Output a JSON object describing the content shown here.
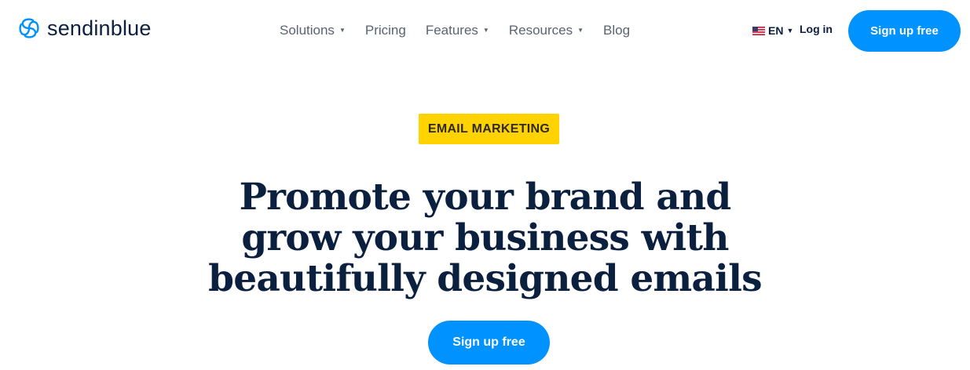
{
  "brand": {
    "name": "sendinblue",
    "accent_color": "#0092ff",
    "text_color": "#0b1f3f",
    "logo_icon": "sendinblue-spiral-logo-icon"
  },
  "nav": {
    "items": [
      {
        "label": "Solutions",
        "has_dropdown": true
      },
      {
        "label": "Pricing",
        "has_dropdown": false
      },
      {
        "label": "Features",
        "has_dropdown": true
      },
      {
        "label": "Resources",
        "has_dropdown": true
      },
      {
        "label": "Blog",
        "has_dropdown": false
      }
    ],
    "dropdown_icon": "caret-down-icon"
  },
  "language": {
    "code": "EN",
    "flag_icon": "us-flag-icon"
  },
  "header": {
    "login_label": "Log in",
    "signup_label": "Sign up free"
  },
  "hero": {
    "badge": "EMAIL MARKETING",
    "badge_color": "#ffd200",
    "headline_lines": [
      "Promote your brand and",
      "grow your business with",
      "beautifully designed emails"
    ],
    "cta_label": "Sign up free"
  }
}
